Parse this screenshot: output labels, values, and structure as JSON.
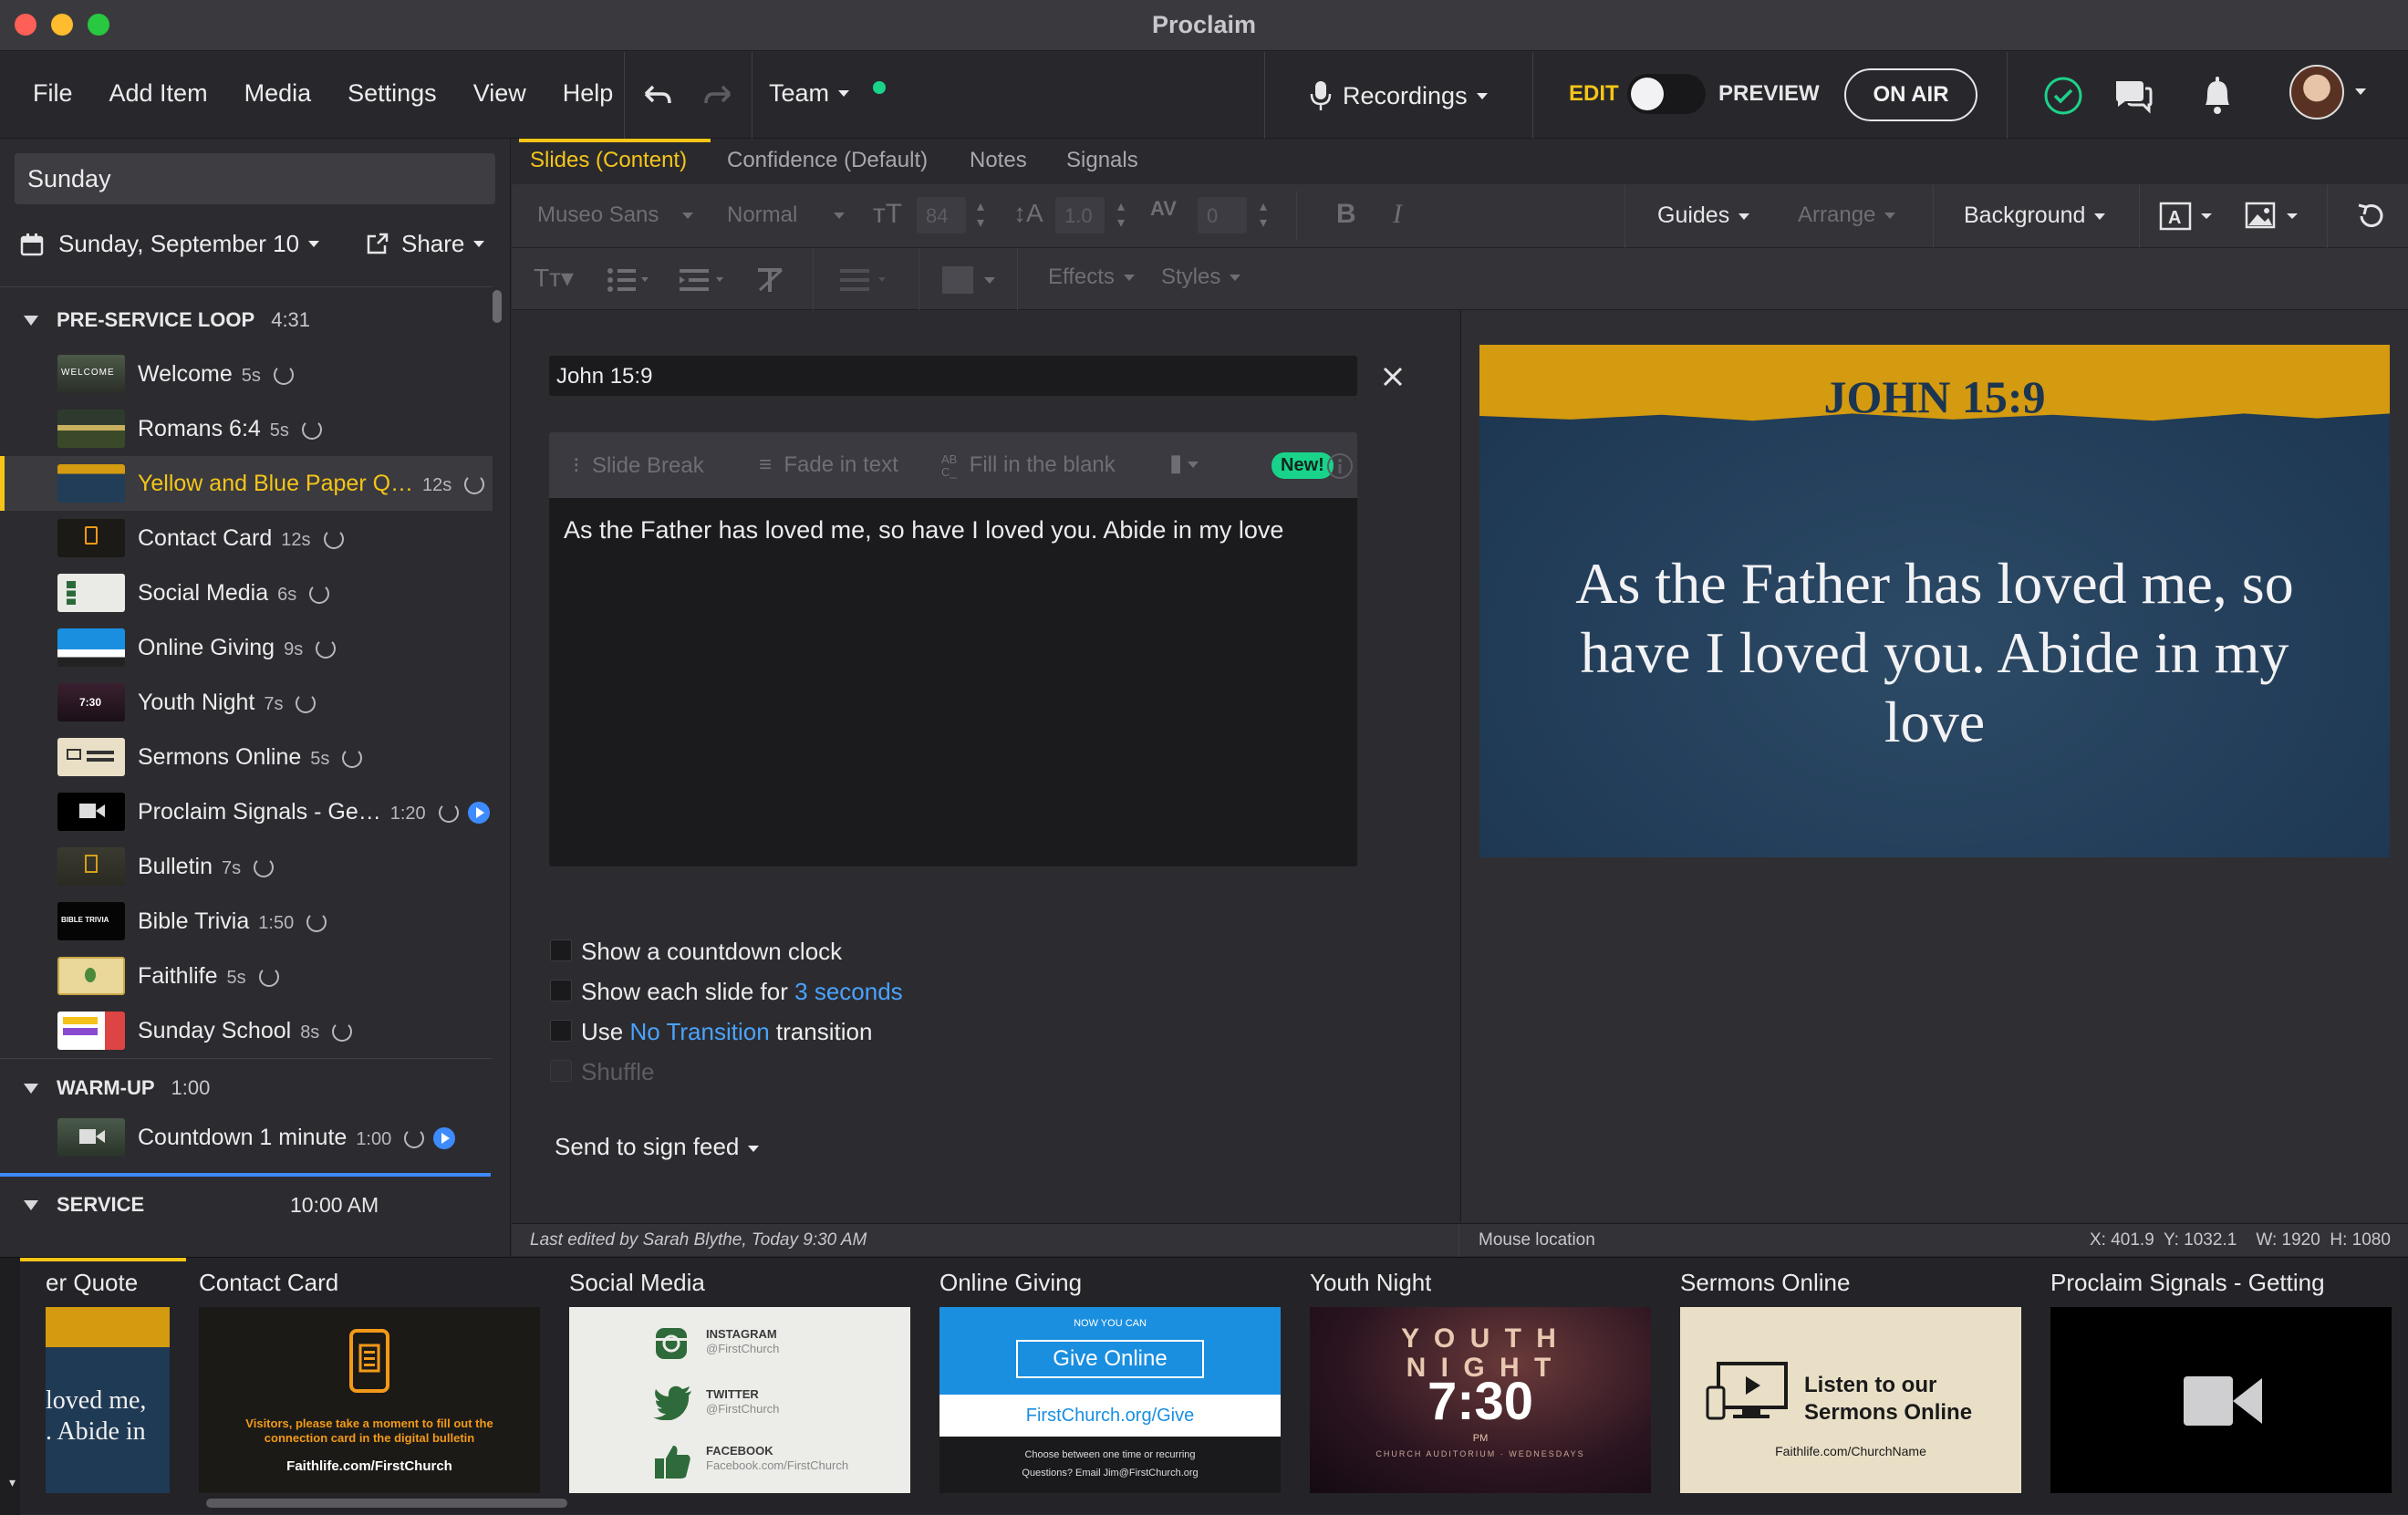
{
  "window": {
    "title": "Proclaim"
  },
  "menu": [
    "File",
    "Add Item",
    "Media",
    "Settings",
    "View",
    "Help"
  ],
  "team": {
    "label": "Team",
    "status_color": "#19d38a"
  },
  "recordings": {
    "label": "Recordings"
  },
  "mode": {
    "edit": "EDIT",
    "preview": "PREVIEW",
    "on_air": "ON AIR"
  },
  "sidebar": {
    "presentation_name": "Sunday",
    "date_label": "Sunday, September 10",
    "share_label": "Share",
    "groups": [
      {
        "name": "PRE-SERVICE LOOP",
        "duration": "4:31"
      },
      {
        "name": "WARM-UP",
        "duration": "1:00"
      },
      {
        "name": "SERVICE",
        "time": "10:00 AM"
      }
    ],
    "items": [
      {
        "name": "Welcome",
        "duration": "5s"
      },
      {
        "name": "Romans 6:4",
        "duration": "5s"
      },
      {
        "name": "Yellow and Blue Paper Q…",
        "duration": "12s",
        "selected": true
      },
      {
        "name": "Contact Card",
        "duration": "12s"
      },
      {
        "name": "Social Media",
        "duration": "6s"
      },
      {
        "name": "Online Giving",
        "duration": "9s"
      },
      {
        "name": "Youth Night",
        "duration": "7s"
      },
      {
        "name": "Sermons Online",
        "duration": "5s"
      },
      {
        "name": "Proclaim Signals - Ge…",
        "duration": "1:20"
      },
      {
        "name": "Bulletin",
        "duration": "7s"
      },
      {
        "name": "Bible Trivia",
        "duration": "1:50"
      },
      {
        "name": "Faithlife",
        "duration": "5s"
      },
      {
        "name": "Sunday School",
        "duration": "8s"
      },
      {
        "name": "Countdown 1 minute",
        "duration": "1:00"
      }
    ],
    "thumb_texts": {
      "welcome": "WELCOME",
      "youth": "7:30",
      "trivia": "BIBLE TRIVIA"
    }
  },
  "tabs": [
    "Slides (Content)",
    "Confidence (Default)",
    "Notes",
    "Signals"
  ],
  "toolbar": {
    "font": "Museo Sans",
    "weight": "Normal",
    "size": "84",
    "line_height": "1.0",
    "spacing": "0",
    "guides": "Guides",
    "arrange": "Arrange",
    "background": "Background",
    "effects": "Effects",
    "styles": "Styles",
    "bold": "B",
    "italic": "I"
  },
  "editor": {
    "title_value": "John 15:9",
    "slide_break": "Slide Break",
    "fade_in": "Fade in text",
    "fill_blank": "Fill in the blank",
    "new_badge": "New!",
    "content": "As the Father has loved me, so have I loved you. Abide in my love",
    "countdown_label": "Show a countdown clock",
    "each_slide_prefix": "Show each slide for",
    "each_slide_link": "3 seconds",
    "use_prefix": "Use",
    "transition_link": "No Transition",
    "transition_suffix": "transition",
    "shuffle_label": "Shuffle",
    "send_sign_feed": "Send to sign feed"
  },
  "preview": {
    "heading": "JOHN 15:9",
    "body": "As the Father has loved me, so have I loved you. Abide in my love",
    "heading_band_color": "#d49a10",
    "body_bg_color": "#223d57"
  },
  "status": {
    "last_edited": "Last edited by Sarah Blythe, Today 9:30 AM",
    "mouse": "Mouse location",
    "coords": "X: 401.9  Y: 1032.1    W: 1920  H: 1080"
  },
  "filmstrip": {
    "items": [
      "er Quote",
      "Contact Card",
      "Social Media",
      "Online Giving",
      "Youth Night",
      "Sermons Online",
      "Proclaim Signals - Getting"
    ],
    "quote_partial": "loved me,\n. Abide in",
    "contact": {
      "text": "Visitors, please take a moment to fill out the connection card in the digital bulletin",
      "url": "Faithlife.com/FirstChurch"
    },
    "social": {
      "instagram": "INSTAGRAM",
      "ig_handle": "@FirstChurch",
      "twitter": "TWITTER",
      "tw_handle": "@FirstChurch",
      "facebook": "FACEBOOK",
      "fb_handle": "Facebook.com/FirstChurch"
    },
    "giving": {
      "now": "NOW YOU CAN",
      "button": "Give Online",
      "url": "FirstChurch.org/Give",
      "note1": "Choose between one time or recurring",
      "note2": "Questions? Email Jim@FirstChurch.org"
    },
    "youth": {
      "line1": "Y O U T H",
      "line2": "N I G H T",
      "time": "7:30",
      "pm": "PM",
      "sub": "CHURCH AUDITORIUM · WEDNESDAYS"
    },
    "sermons": {
      "line1": "Listen to our",
      "line2": "Sermons Online",
      "url": "Faithlife.com/ChurchName"
    }
  }
}
